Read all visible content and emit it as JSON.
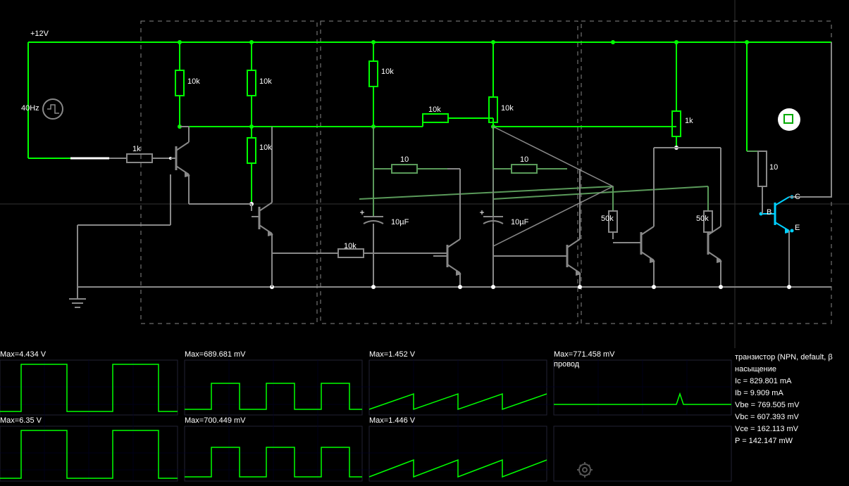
{
  "schematic": {
    "supply_label": "+12V",
    "source_freq": "40Hz",
    "resistors": {
      "r_in": "1k",
      "r1": "10k",
      "r2": "10k",
      "r3": "10k",
      "r4": "10k",
      "r5": "10k",
      "r6": "10k",
      "r7": "10",
      "r8": "10",
      "r9": "50k",
      "r10": "50k",
      "r_out_top": "1k",
      "r_out": "10",
      "r_fb": "10k"
    },
    "caps": {
      "c1": "10µF",
      "c2": "10µF"
    },
    "bjt_terminals": {
      "c": "C",
      "b": "B",
      "e": "E"
    }
  },
  "scopes": [
    {
      "label": "Max=4.434 V"
    },
    {
      "label": "Max=689.681 mV"
    },
    {
      "label": "Max=1.452 V"
    },
    {
      "label": "Max=771.458 mV",
      "sublabel": "провод"
    },
    {
      "label": "Max=6.35 V"
    },
    {
      "label": "Max=700.449 mV"
    },
    {
      "label": "Max=1.446 V"
    }
  ],
  "info": {
    "line1": "транзистор (NPN, default, β",
    "line2": "насыщение",
    "ic": "Ic = 829.801 mA",
    "ib": "Ib = 9.909 mA",
    "vbe": "Vbe = 769.505 mV",
    "vbc": "Vbc = 607.393 mV",
    "vce": "Vce = 162.113 mV",
    "p": "P = 142.147 mW"
  }
}
